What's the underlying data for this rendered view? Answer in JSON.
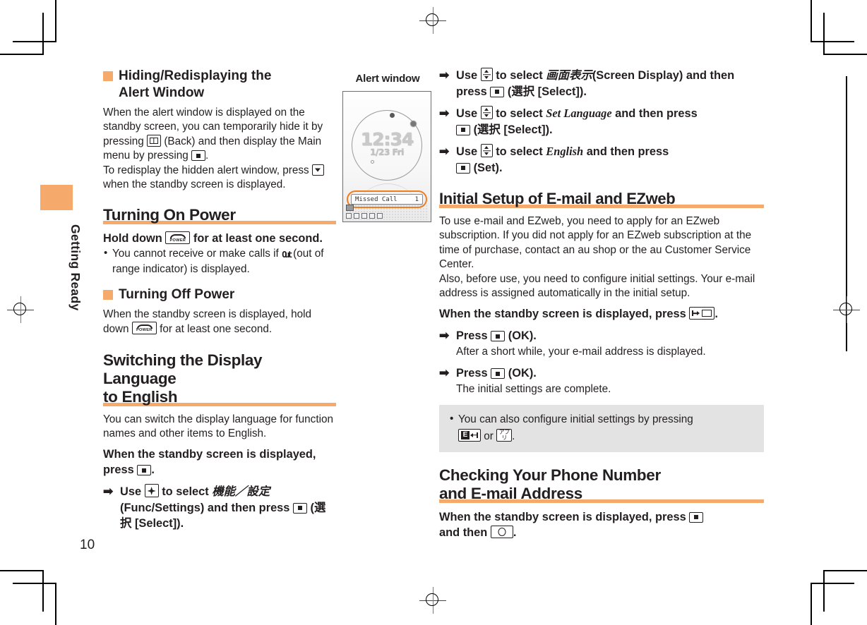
{
  "page": {
    "number": "10",
    "sidebar_label": "Getting Ready"
  },
  "figure": {
    "caption": "Alert window",
    "phone": {
      "time": "12:34",
      "date": "1/23 Fri",
      "alert_label": "Missed Call",
      "alert_count": "1"
    }
  },
  "left_column": {
    "sub1": {
      "title_line1": "Hiding/Redisplaying the",
      "title_line2": "Alert Window",
      "body_a": "When the alert window is displayed on the standby screen, you can temporarily hide it by pressing",
      "body_b": "(Back) and then display the Main menu by pressing",
      "body_c": ".",
      "body_d": "To redisplay the hidden alert window, press",
      "body_e": "when the standby screen is displayed."
    },
    "section_turning_on": {
      "heading": "Turning On Power",
      "bold_a": "Hold down",
      "bold_b": "for at least one second.",
      "bullet_a": "You cannot receive or make calls if",
      "bullet_out": "Out",
      "bullet_b": "(out of range indicator) is displayed."
    },
    "sub_turning_off": {
      "title": "Turning Off Power",
      "body_a": "When the standby screen is displayed, hold down",
      "body_b": "for at least one second."
    },
    "section_switching": {
      "heading_line1": "Switching the Display Language",
      "heading_line2": "to English",
      "body": "You can switch the display language for function names and other items to English.",
      "bold_a": "When the standby screen is displayed, press",
      "bold_b": ".",
      "step1_a": "Use",
      "step1_b": "to select",
      "step1_jp": "機能／設定",
      "step1_c": "(Func/Settings) and then press",
      "step1_d": "(",
      "step1_jp2": "選択",
      "step1_e": " [Select])."
    }
  },
  "right_column": {
    "steps_top": [
      {
        "a": "Use",
        "b": "to select",
        "jp": "画面表示",
        "c": "(Screen Display) and then press",
        "d": "(",
        "jp2": "選択",
        "e": " [Select])."
      },
      {
        "a": "Use",
        "b": "to select",
        "ital": "Set Language",
        "c": "and then press",
        "d": "(",
        "jp2": "選択",
        "e": " [Select])."
      },
      {
        "a": "Use",
        "b": "to select",
        "ital": "English",
        "c": "and then press",
        "d": "(Set)."
      }
    ],
    "section_initial_setup": {
      "heading": "Initial Setup of E-mail and EZweb",
      "body_p1": "To use e-mail and EZweb, you need to apply for an EZweb subscription. If you did not apply for an EZweb subscription at the time of purchase, contact an au shop or the au Customer Service Center.",
      "body_p2": "Also, before use, you need to configure initial settings. Your e-mail address is assigned automatically in the initial setup.",
      "bold_a": "When the standby screen is displayed, press",
      "bold_b": ".",
      "step1": "Press",
      "step1_label": "(OK).",
      "step1_note": "After a short while, your e-mail address is displayed.",
      "step2": "Press",
      "step2_label": "(OK).",
      "step2_note": "The initial settings are complete.",
      "note_a": "You can also configure initial settings by pressing",
      "note_or": "or",
      "note_end": "."
    },
    "section_checking": {
      "heading_line1": "Checking Your Phone Number",
      "heading_line2": "and E-mail Address",
      "bold_a": "When the standby screen is displayed, press",
      "bold_b": "and then",
      "bold_c": "."
    }
  },
  "icons": {
    "center_key": "center-select-key",
    "down_key": "down-arrow-key",
    "updown_key": "up-down-arrow-key",
    "pad_key": "four-way-pad-key",
    "back_key": "back-key",
    "power_key": "power-key",
    "mail_key": "mail-key",
    "ez_key": "ez-key",
    "app_key": "app-key",
    "o_key": "o-key",
    "arrow": "➡"
  },
  "colors": {
    "accent": "#f5a96b",
    "alert_ring": "#f07d1e",
    "note_bg": "#e3e3e3",
    "text": "#231f20"
  }
}
